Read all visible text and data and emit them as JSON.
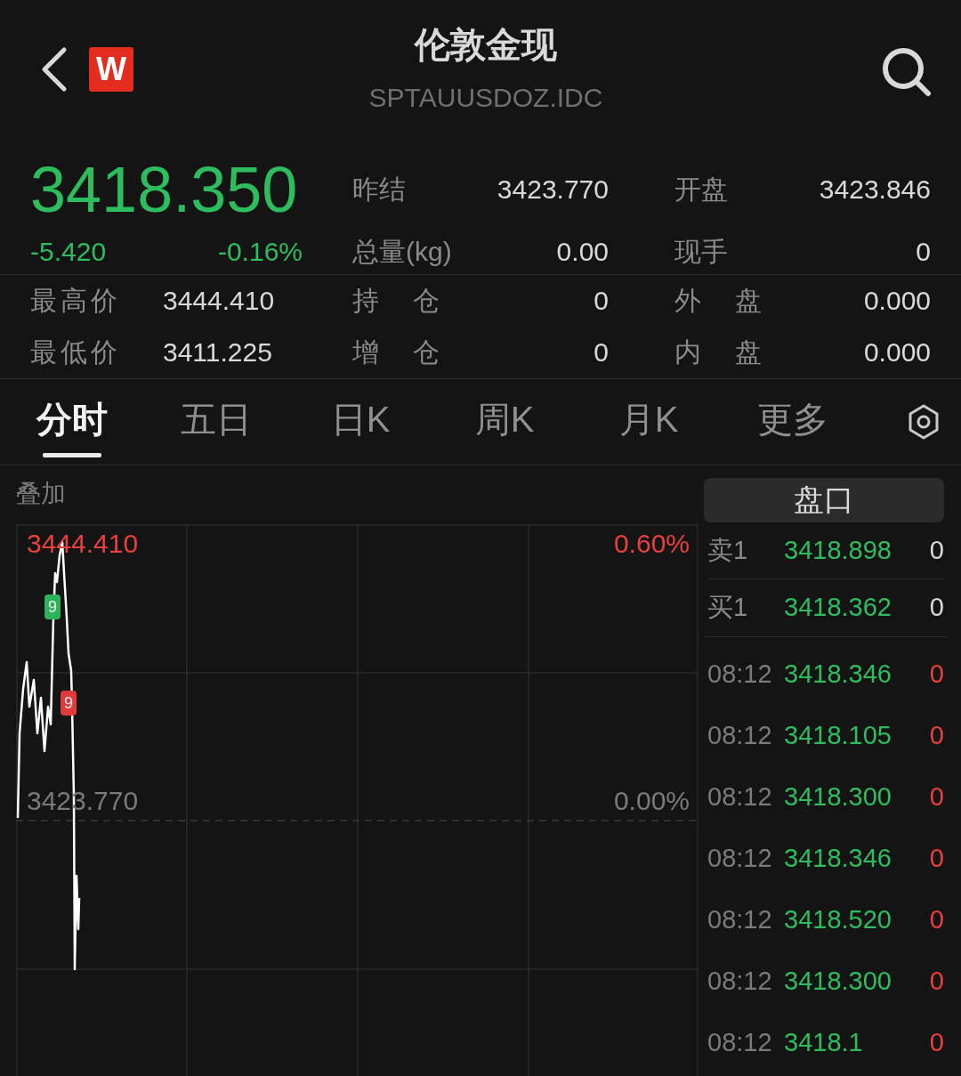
{
  "header": {
    "logo_text": "W",
    "title": "伦敦金现",
    "code": "SPTAUUSDOZ.IDC"
  },
  "quote": {
    "price": "3418.350",
    "change": "-5.420",
    "change_pct": "-0.16%"
  },
  "summary_stats": [
    {
      "label": "昨结",
      "value": "3423.770"
    },
    {
      "label": "开盘",
      "value": "3423.846"
    },
    {
      "label": "总量(kg)",
      "value": "0.00"
    },
    {
      "label": "现手",
      "value": "0"
    }
  ],
  "detail_stats": [
    {
      "label": "最高价",
      "value": "3444.410"
    },
    {
      "label": "持 仓",
      "value": "0"
    },
    {
      "label": "外 盘",
      "value": "0.000"
    },
    {
      "label": "最低价",
      "value": "3411.225"
    },
    {
      "label": "增 仓",
      "value": "0"
    },
    {
      "label": "内 盘",
      "value": "0.000"
    }
  ],
  "tabs": [
    {
      "label": "分时",
      "selected": true
    },
    {
      "label": "五日",
      "selected": false
    },
    {
      "label": "日K",
      "selected": false
    },
    {
      "label": "周K",
      "selected": false
    },
    {
      "label": "月K",
      "selected": false
    },
    {
      "label": "更多",
      "selected": false
    }
  ],
  "overlay_label": "叠加",
  "chart": {
    "high_price": "3444.410",
    "base_price": "3423.770",
    "high_pct": "0.60%",
    "base_pct": "0.00%",
    "markers": [
      {
        "text": "9",
        "color": "#2fb35a"
      },
      {
        "text": "9",
        "color": "#e03a3a"
      }
    ]
  },
  "panel": {
    "title": "盘口",
    "book": [
      {
        "label": "卖1",
        "price": "3418.898",
        "qty": "0"
      },
      {
        "label": "买1",
        "price": "3418.362",
        "qty": "0"
      }
    ],
    "trades": [
      {
        "time": "08:12",
        "price": "3418.346",
        "qty": "0"
      },
      {
        "time": "08:12",
        "price": "3418.105",
        "qty": "0"
      },
      {
        "time": "08:12",
        "price": "3418.300",
        "qty": "0"
      },
      {
        "time": "08:12",
        "price": "3418.346",
        "qty": "0"
      },
      {
        "time": "08:12",
        "price": "3418.520",
        "qty": "0"
      },
      {
        "time": "08:12",
        "price": "3418.300",
        "qty": "0"
      },
      {
        "time": "08:12",
        "price": "3418.1",
        "qty": "0"
      }
    ]
  }
}
